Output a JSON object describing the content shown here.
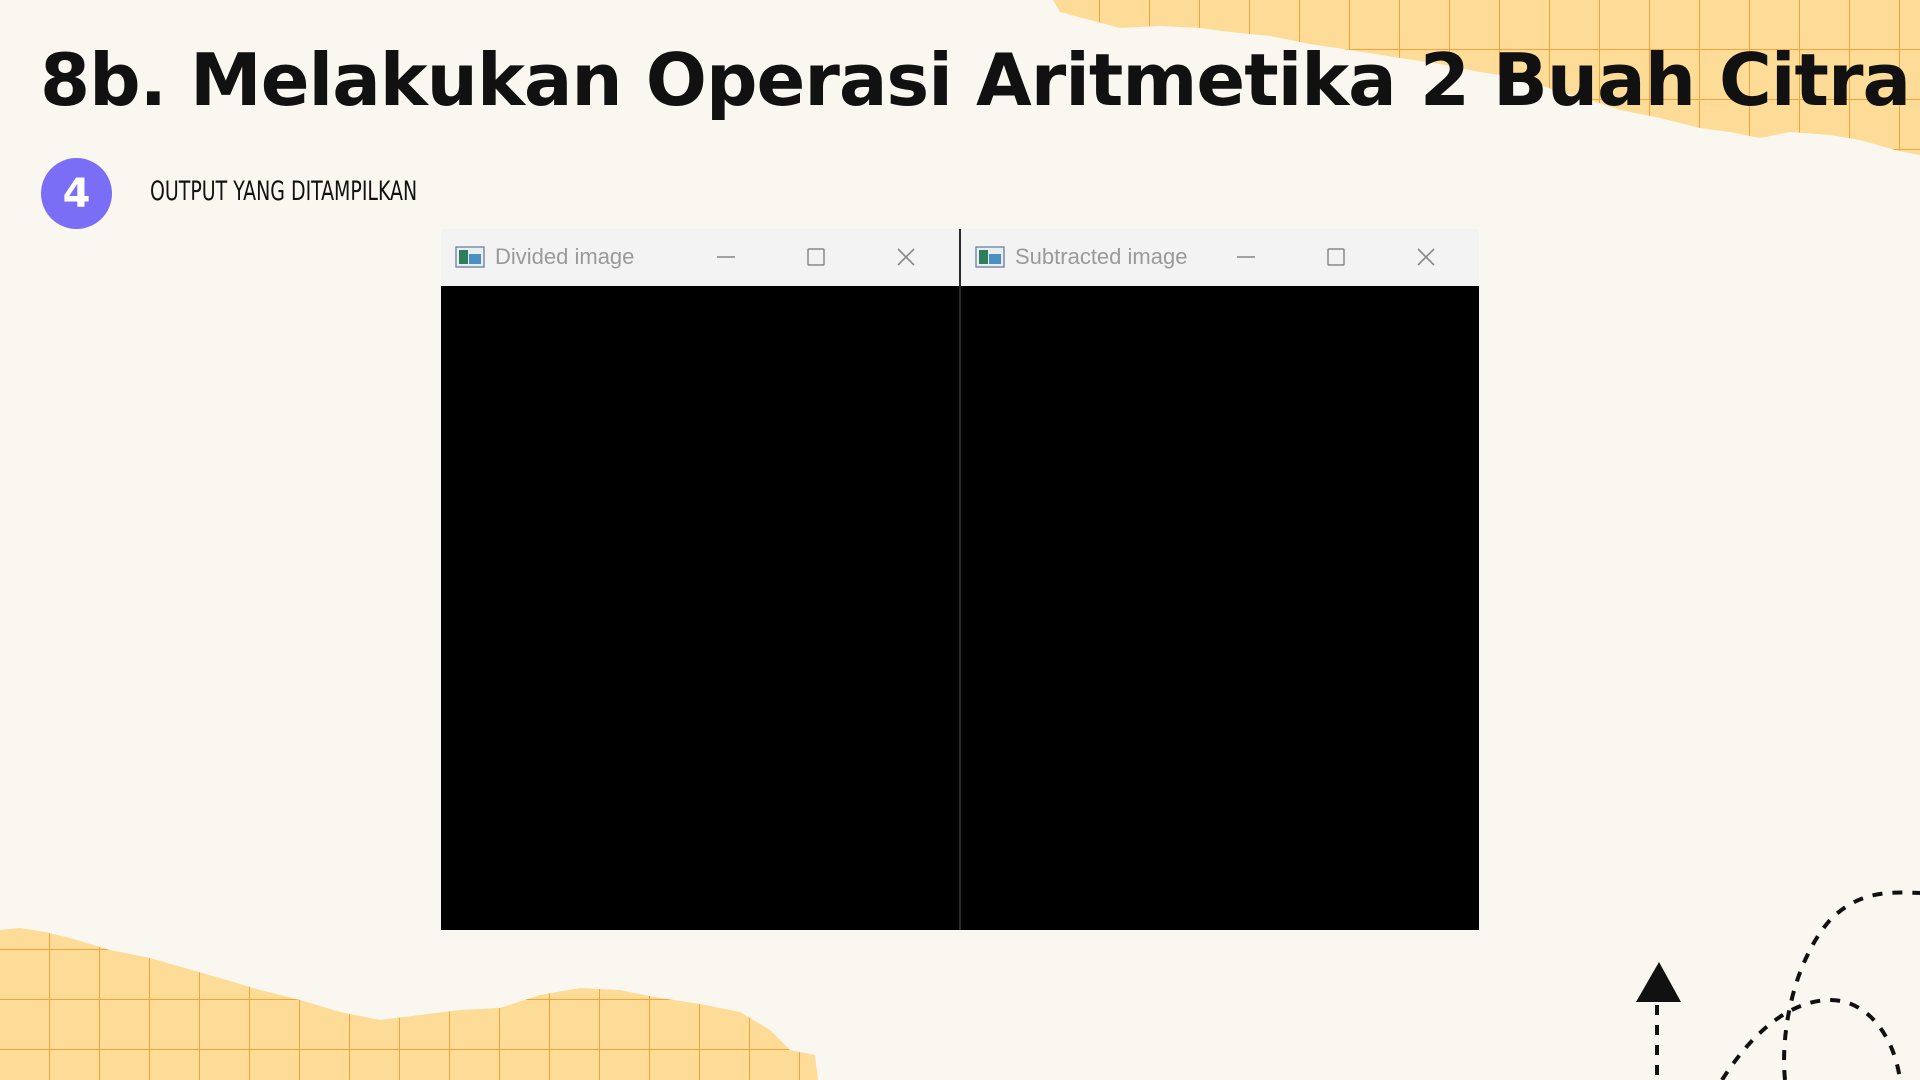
{
  "slide": {
    "title": "8b. Melakukan Operasi Aritmetika 2 Buah Citra",
    "step_number": "4",
    "step_label": "OUTPUT YANG DITAMPILKAN"
  },
  "windows": [
    {
      "title": "Divided image",
      "icon": "image-window-icon",
      "controls": [
        "minimize-icon",
        "maximize-icon",
        "close-icon"
      ]
    },
    {
      "title": "Subtracted image",
      "icon": "image-window-icon",
      "controls": [
        "minimize-icon",
        "maximize-icon",
        "close-icon"
      ]
    }
  ],
  "colors": {
    "background": "#faf7f0",
    "badge": "#7b6ef6",
    "grid_paper": "#fddc98",
    "grid_lines": "#f7a23a",
    "titlebar": "#f3f3f3",
    "image_content": "#000000"
  }
}
